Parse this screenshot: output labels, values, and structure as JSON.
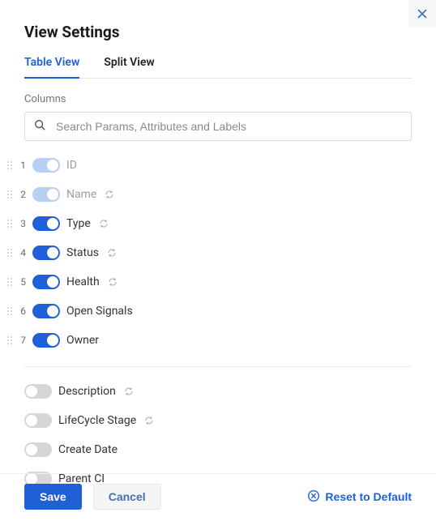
{
  "title": "View Settings",
  "tabs": [
    {
      "label": "Table View",
      "active": true
    },
    {
      "label": "Split View",
      "active": false
    }
  ],
  "columns_label": "Columns",
  "search": {
    "placeholder": "Search Params, Attributes and Labels"
  },
  "enabled_columns": [
    {
      "index": "1",
      "label": "ID",
      "state": "on-disabled",
      "attr_icon": false,
      "muted": true
    },
    {
      "index": "2",
      "label": "Name",
      "state": "on-disabled",
      "attr_icon": true,
      "muted": true
    },
    {
      "index": "3",
      "label": "Type",
      "state": "on",
      "attr_icon": true,
      "muted": false
    },
    {
      "index": "4",
      "label": "Status",
      "state": "on",
      "attr_icon": true,
      "muted": false
    },
    {
      "index": "5",
      "label": "Health",
      "state": "on",
      "attr_icon": true,
      "muted": false
    },
    {
      "index": "6",
      "label": "Open Signals",
      "state": "on",
      "attr_icon": false,
      "muted": false
    },
    {
      "index": "7",
      "label": "Owner",
      "state": "on",
      "attr_icon": false,
      "muted": false
    }
  ],
  "disabled_columns": [
    {
      "label": "Description",
      "state": "off",
      "attr_icon": true
    },
    {
      "label": "LifeCycle Stage",
      "state": "off",
      "attr_icon": true
    },
    {
      "label": "Create Date",
      "state": "off",
      "attr_icon": false
    },
    {
      "label": "Parent CI",
      "state": "off",
      "attr_icon": false
    }
  ],
  "footer": {
    "save": "Save",
    "cancel": "Cancel",
    "reset": "Reset to Default"
  }
}
